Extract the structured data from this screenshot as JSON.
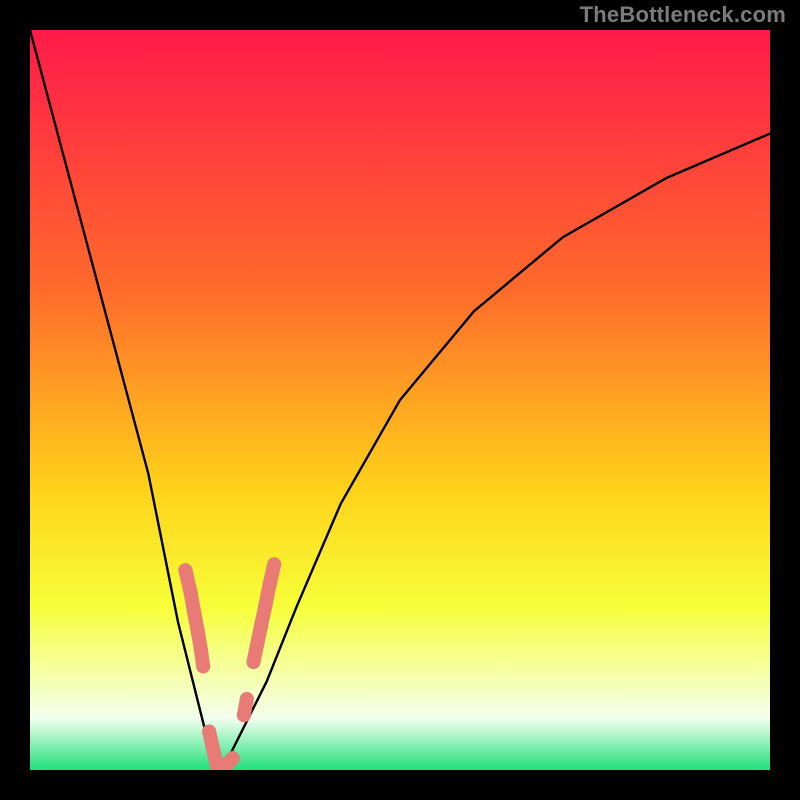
{
  "watermark": "TheBottleneck.com",
  "colors": {
    "top": "#ff1a4a",
    "q1": "#ff6a2b",
    "mid": "#ffd21a",
    "q3": "#f7ff3a",
    "pale": "#f4ffef",
    "bot": "#20e07a",
    "frame": "#000000",
    "curve": "#000000",
    "beads": "#e87b76"
  },
  "chart_data": {
    "type": "line",
    "title": "",
    "xlabel": "",
    "ylabel": "",
    "xlim": [
      0,
      100
    ],
    "ylim": [
      0,
      100
    ],
    "curve_left": {
      "x": [
        0,
        4,
        8,
        12,
        16,
        18,
        20,
        22,
        23.5,
        24.5,
        25.5
      ],
      "y": [
        100,
        85,
        70,
        55,
        40,
        30,
        20,
        12,
        6,
        2,
        0
      ]
    },
    "curve_right": {
      "x": [
        25.5,
        27,
        29,
        32,
        36,
        42,
        50,
        60,
        72,
        86,
        100
      ],
      "y": [
        0,
        2,
        6,
        12,
        22,
        36,
        50,
        62,
        72,
        80,
        86
      ]
    },
    "minimum_x": 25.5,
    "beads": [
      {
        "x": 21.0,
        "y": 27.0
      },
      {
        "x": 21.7,
        "y": 24.0
      },
      {
        "x": 22.2,
        "y": 21.2
      },
      {
        "x": 22.7,
        "y": 18.6
      },
      {
        "x": 23.1,
        "y": 16.2
      },
      {
        "x": 23.4,
        "y": 14.0
      },
      {
        "x": 24.2,
        "y": 5.2
      },
      {
        "x": 24.8,
        "y": 2.6
      },
      {
        "x": 25.2,
        "y": 0.8
      },
      {
        "x": 25.8,
        "y": 0.6
      },
      {
        "x": 26.3,
        "y": 0.7
      },
      {
        "x": 26.8,
        "y": 0.9
      },
      {
        "x": 27.4,
        "y": 1.6
      },
      {
        "x": 28.9,
        "y": 7.4
      },
      {
        "x": 29.3,
        "y": 9.6
      },
      {
        "x": 30.2,
        "y": 14.6
      },
      {
        "x": 30.7,
        "y": 17.0
      },
      {
        "x": 31.2,
        "y": 19.4
      },
      {
        "x": 31.8,
        "y": 22.2
      },
      {
        "x": 32.4,
        "y": 25.2
      },
      {
        "x": 33.0,
        "y": 27.8
      }
    ]
  }
}
